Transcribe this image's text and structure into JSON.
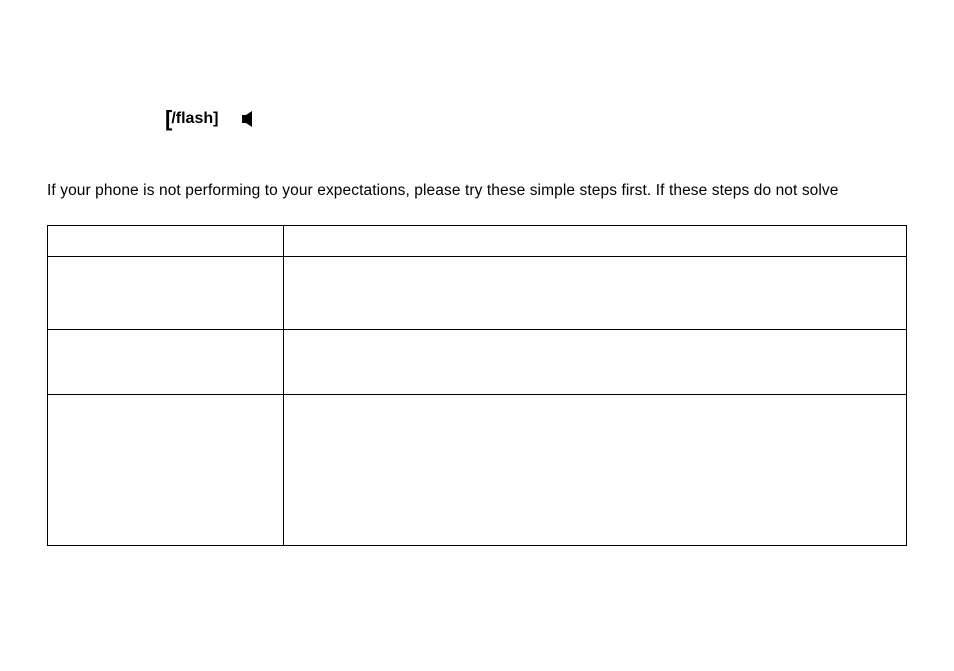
{
  "top": {
    "bracket_open": "[",
    "flash_label": "/flash]",
    "icon_name": "speaker-icon"
  },
  "intro": {
    "text": "If your phone is not performing to your expectations, please try these simple steps first. If these steps do not solve"
  },
  "table": {
    "rows": [
      {
        "c0": "",
        "c1": ""
      },
      {
        "c0": "",
        "c1": ""
      },
      {
        "c0": "",
        "c1": ""
      },
      {
        "c0": "",
        "c1": ""
      }
    ]
  }
}
